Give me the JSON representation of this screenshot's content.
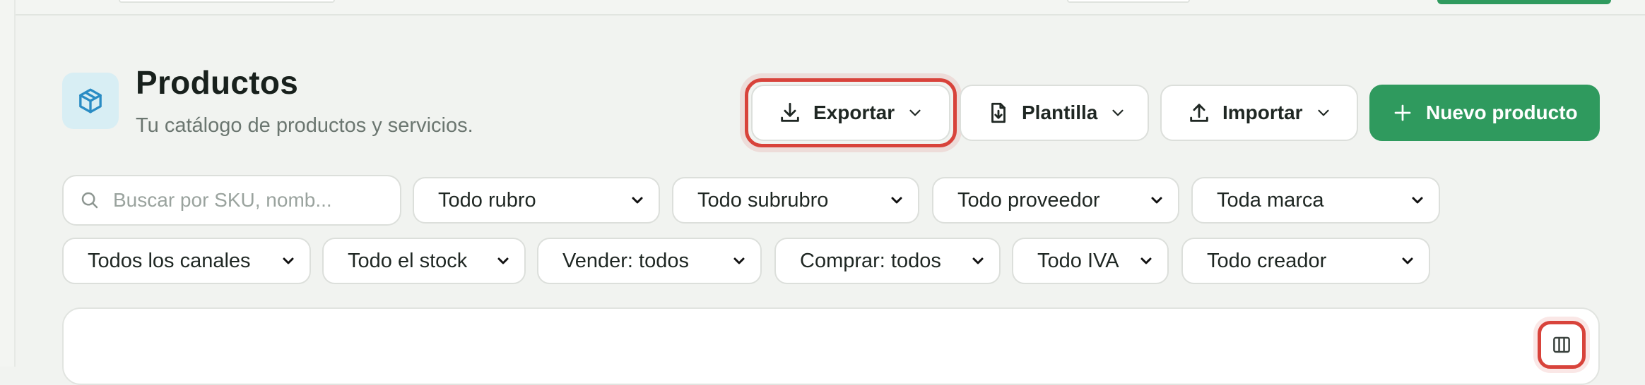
{
  "header": {
    "title": "Productos",
    "subtitle": "Tu catálogo de productos y servicios.",
    "logo_icon": "package-icon"
  },
  "actions": {
    "export": {
      "label": "Exportar",
      "icon": "download-icon"
    },
    "template": {
      "label": "Plantilla",
      "icon": "file-download-icon"
    },
    "import": {
      "label": "Importar",
      "icon": "upload-icon"
    },
    "new": {
      "label": "Nuevo producto",
      "icon": "plus-icon"
    }
  },
  "search": {
    "placeholder": "Buscar por SKU, nomb...",
    "value": ""
  },
  "filters_row1": [
    "Todo rubro",
    "Todo subrubro",
    "Todo proveedor",
    "Toda marca"
  ],
  "filters_row2": [
    "Todos los canales",
    "Todo el stock",
    "Vender: todos",
    "Comprar: todos",
    "Todo IVA",
    "Todo creador"
  ],
  "table": {
    "columns_icon": "columns-icon"
  },
  "colors": {
    "accent": "#2f9a5e",
    "highlight": "#d8433b",
    "logo_bg": "#d8eef4",
    "icon_blue": "#2a8cc4"
  }
}
